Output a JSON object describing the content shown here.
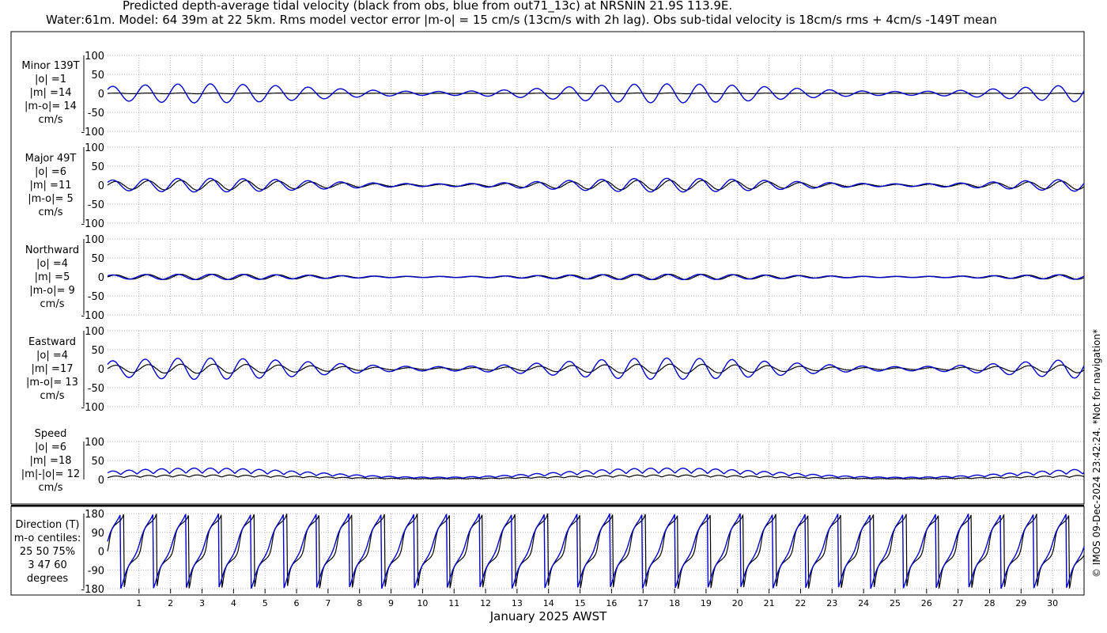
{
  "title_line1": "Predicted depth-average tidal velocity (black from obs, blue from out71_13c) at NRSNIN 21.9S 113.9E.",
  "title_line2": "Water:61m. Model: 64 39m at 22 5km. Rms model vector error |m-o| = 15 cm/s (13cm/s with 2h lag). Obs sub-tidal velocity is 18cm/s rms + 4cm/s -149T mean",
  "credit": "© IMOS 09-Dec-2024 23:42:24. *Not for navigation*",
  "x_label": "January 2025 AWST",
  "x_ticks": [
    "1",
    "2",
    "3",
    "4",
    "5",
    "6",
    "7",
    "8",
    "9",
    "10",
    "11",
    "12",
    "13",
    "14",
    "15",
    "16",
    "17",
    "18",
    "19",
    "20",
    "21",
    "22",
    "23",
    "24",
    "25",
    "26",
    "27",
    "28",
    "29",
    "30"
  ],
  "colors": {
    "obs": "#000000",
    "model": "#0000cc",
    "grid": "#999999"
  },
  "panels": [
    {
      "id": "minor",
      "lines": [
        "Minor 139T",
        "|o| =1",
        "|m| =14",
        "|m-o|= 14",
        "cm/s"
      ]
    },
    {
      "id": "major",
      "lines": [
        "Major 49T",
        "|o| =6",
        "|m| =11",
        "|m-o|= 5",
        "cm/s"
      ]
    },
    {
      "id": "north",
      "lines": [
        "Northward",
        "|o| =4",
        "|m| =5",
        "|m-o|= 9",
        "cm/s"
      ]
    },
    {
      "id": "east",
      "lines": [
        "Eastward",
        "|o| =4",
        "|m| =17",
        "|m-o|= 13",
        "cm/s"
      ]
    },
    {
      "id": "speed",
      "lines": [
        "Speed",
        "|o| =6",
        "|m| =18",
        "|m|-|o|= 12",
        "cm/s"
      ]
    },
    {
      "id": "dir",
      "lines": [
        "Direction (T)",
        "m-o centiles:",
        "25  50  75%",
        "3  47  60",
        "degrees"
      ]
    }
  ],
  "chart_data": [
    {
      "type": "line",
      "title": "Minor 139T",
      "ylabel": "cm/s",
      "ylim": [
        -100,
        100
      ],
      "yticks": [
        -100,
        -50,
        0,
        50,
        100
      ],
      "grid": true,
      "series": [
        {
          "color": "black",
          "amplitude_cm_s": 1
        },
        {
          "color": "blue",
          "amplitude_cm_s": 25
        }
      ]
    },
    {
      "type": "line",
      "title": "Major 49T",
      "ylabel": "cm/s",
      "ylim": [
        -100,
        100
      ],
      "yticks": [
        -100,
        -50,
        0,
        50,
        100
      ],
      "grid": true,
      "series": [
        {
          "color": "black",
          "amplitude_cm_s": 13
        },
        {
          "color": "blue",
          "amplitude_cm_s": 18
        }
      ]
    },
    {
      "type": "line",
      "title": "Northward",
      "ylabel": "cm/s",
      "ylim": [
        -100,
        100
      ],
      "yticks": [
        -100,
        -50,
        0,
        50,
        100
      ],
      "grid": true,
      "series": [
        {
          "color": "black",
          "amplitude_cm_s": 7
        },
        {
          "color": "blue",
          "amplitude_cm_s": 7
        }
      ]
    },
    {
      "type": "line",
      "title": "Eastward",
      "ylabel": "cm/s",
      "ylim": [
        -100,
        100
      ],
      "yticks": [
        -100,
        -50,
        0,
        50,
        100
      ],
      "grid": true,
      "series": [
        {
          "color": "black",
          "amplitude_cm_s": 12
        },
        {
          "color": "blue",
          "amplitude_cm_s": 28
        }
      ]
    },
    {
      "type": "line",
      "title": "Speed",
      "ylabel": "cm/s",
      "ylim": [
        0,
        100
      ],
      "yticks": [
        0,
        50,
        100
      ],
      "grid": true,
      "series": [
        {
          "color": "black",
          "amplitude_cm_s": 12
        },
        {
          "color": "blue",
          "amplitude_cm_s": 30
        }
      ]
    },
    {
      "type": "line",
      "title": "Direction (T)",
      "ylabel": "degrees",
      "ylim": [
        -180,
        180
      ],
      "yticks": [
        -180,
        -90,
        0,
        90,
        180
      ],
      "grid": true,
      "series": [
        {
          "color": "black"
        },
        {
          "color": "blue"
        }
      ]
    }
  ]
}
